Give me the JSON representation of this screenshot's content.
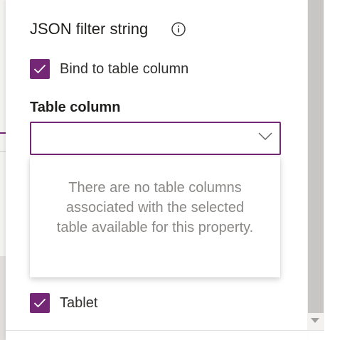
{
  "panel": {
    "title": "JSON filter string",
    "bind_checkbox": {
      "label": "Bind to table column",
      "checked": true
    },
    "table_column": {
      "label": "Table column",
      "value": "",
      "empty_message": "There are no table columns associated with the selected table available for this property."
    },
    "tablet_checkbox": {
      "label": "Tablet",
      "checked": true
    }
  },
  "colors": {
    "accent": "#742774",
    "muted_text": "#8a8886"
  },
  "icons": {
    "info": "info-icon",
    "check": "checkmark-icon",
    "chevron": "chevron-down-icon",
    "scroll_down": "scroll-down-arrow-icon"
  }
}
